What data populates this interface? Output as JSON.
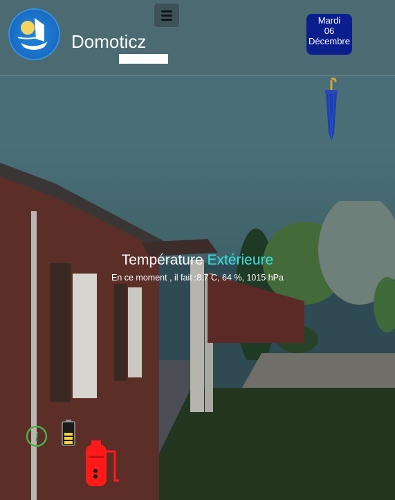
{
  "header": {
    "brand": "Domoticz",
    "date": {
      "weekday": "Mardi",
      "day": "06",
      "month": "Décembre"
    }
  },
  "weather": {
    "title_main": "Température",
    "title_accent": "Extérieure",
    "summary_prefix": "En ce moment , il fait",
    "summary_values": ":8.7 C, 64 %, 1015 hPa"
  },
  "colors": {
    "accent": "#37e3e3",
    "date_bg": "#0a1e8e",
    "boiler": "#ff1a1a",
    "battery": "#f2d33a",
    "info": "#4caf50"
  },
  "icons": [
    "menu-icon",
    "umbrella-icon",
    "info-icon",
    "battery-icon",
    "boiler-icon"
  ]
}
